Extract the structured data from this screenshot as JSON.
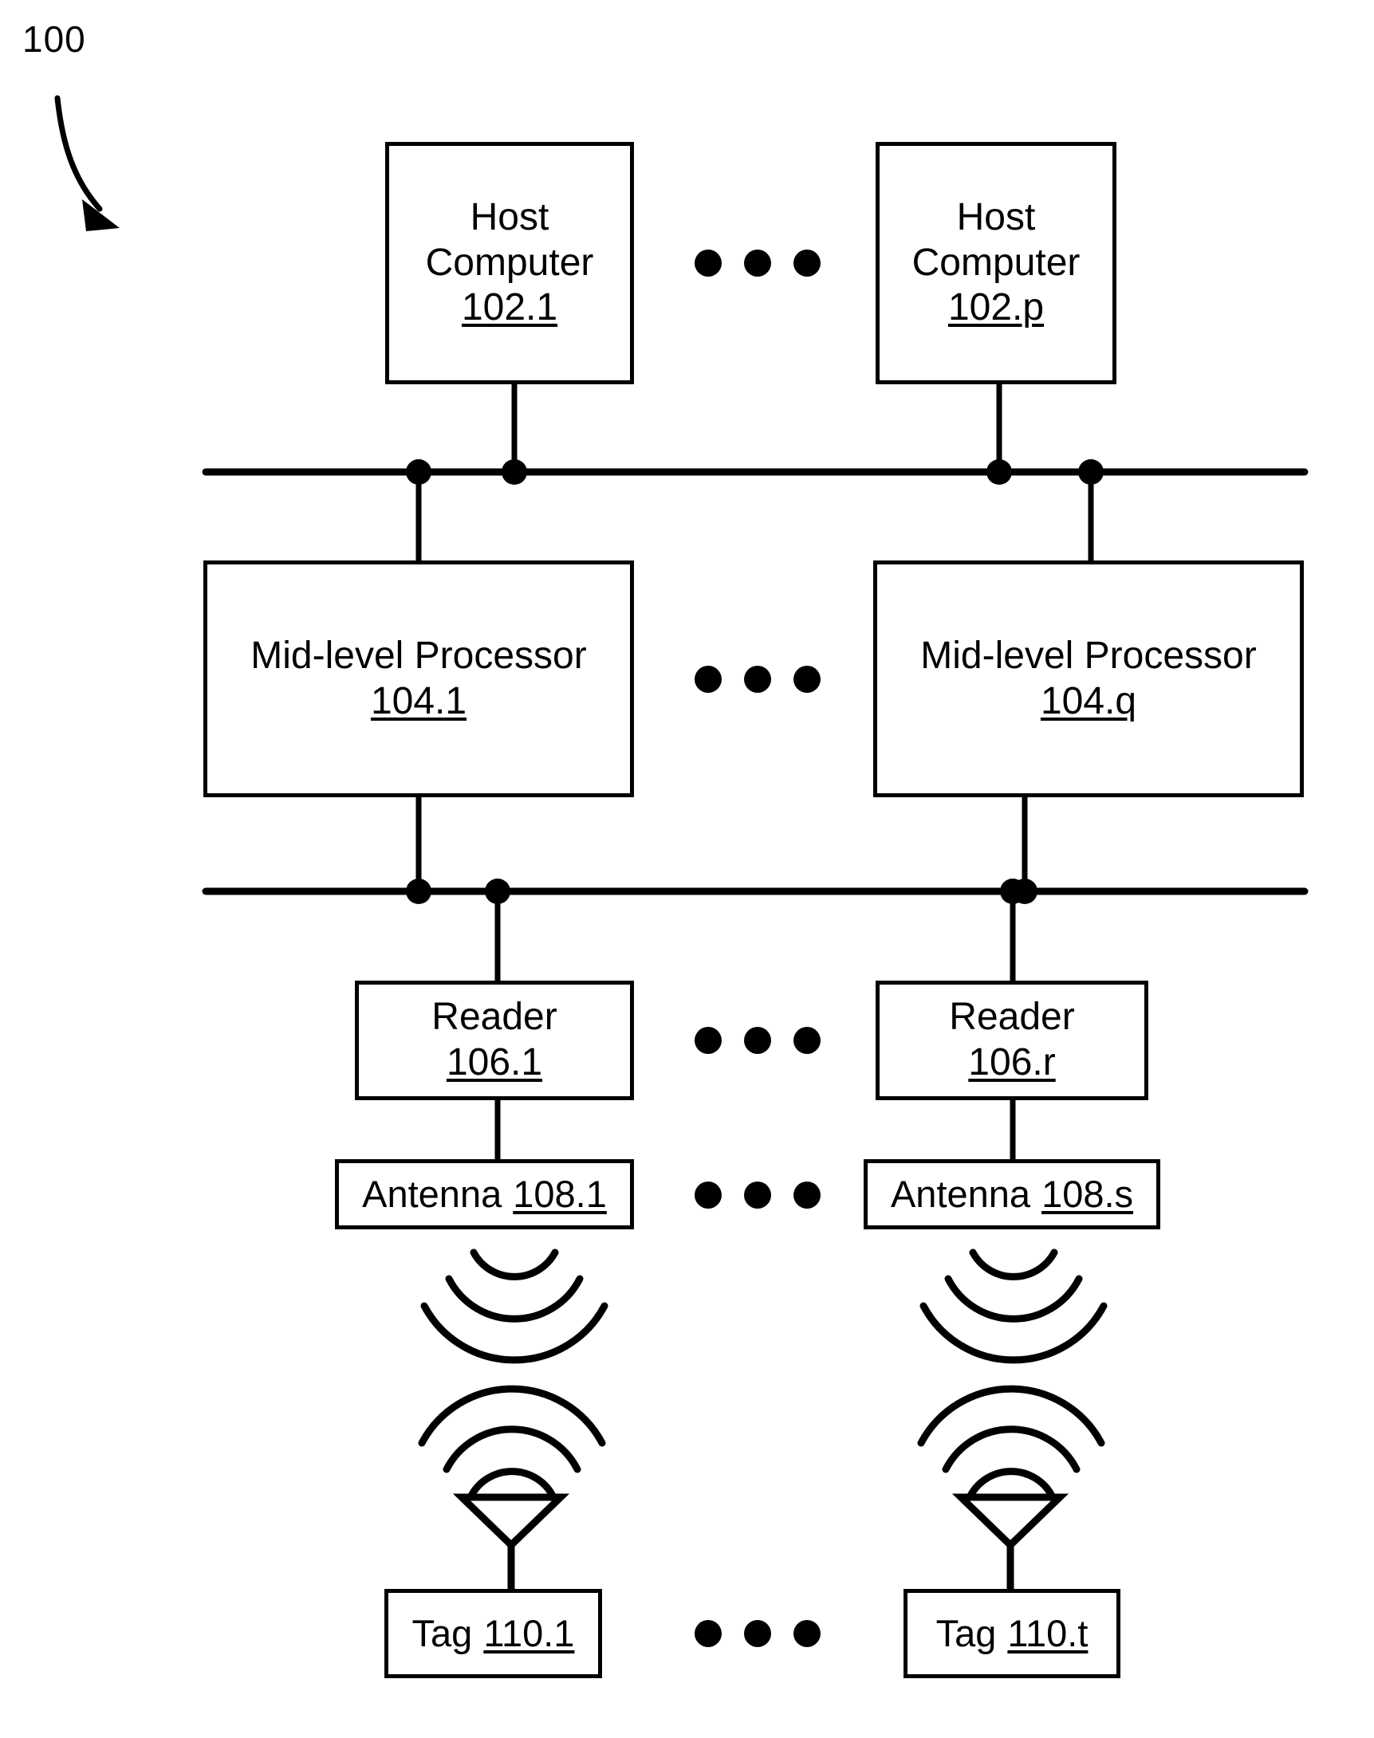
{
  "figure": {
    "number_label": "100",
    "title": "RFID system block diagram",
    "stroke_color": "#000000",
    "background_color": "#ffffff"
  },
  "tiers": {
    "hosts": {
      "tier_name": "Host Computer tier",
      "nodes": [
        {
          "id": "host-1",
          "line1": "Host",
          "line2": "Computer",
          "ref": "102.1"
        },
        {
          "id": "host-p",
          "line1": "Host",
          "line2": "Computer",
          "ref": "102.p"
        }
      ],
      "ellipsis_dots": 3
    },
    "processors": {
      "tier_name": "Mid-level Processor tier",
      "nodes": [
        {
          "id": "proc-1",
          "line1": "Mid-level Processor",
          "ref": "104.1"
        },
        {
          "id": "proc-q",
          "line1": "Mid-level Processor",
          "ref": "104.q"
        }
      ],
      "ellipsis_dots": 3
    },
    "readers": {
      "tier_name": "Reader tier",
      "nodes": [
        {
          "id": "reader-1",
          "line1": "Reader",
          "ref": "106.1"
        },
        {
          "id": "reader-r",
          "line1": "Reader",
          "ref": "106.r"
        }
      ],
      "ellipsis_dots": 3
    },
    "antennas": {
      "tier_name": "Antenna tier",
      "nodes": [
        {
          "id": "antenna-1",
          "line1": "Antenna",
          "ref": "108.1"
        },
        {
          "id": "antenna-s",
          "line1": "Antenna",
          "ref": "108.s"
        }
      ],
      "ellipsis_dots": 3
    },
    "tags": {
      "tier_name": "Tag tier",
      "nodes": [
        {
          "id": "tag-1",
          "line1": "Tag",
          "ref": "110.1"
        },
        {
          "id": "tag-t",
          "line1": "Tag",
          "ref": "110.t"
        }
      ],
      "ellipsis_dots": 3
    }
  },
  "buses": [
    {
      "id": "upper-bus",
      "name": "host-to-processor bus",
      "junction_count": 4
    },
    {
      "id": "lower-bus",
      "name": "processor-to-reader bus",
      "junction_count": 4
    }
  ],
  "rf_links": [
    {
      "id": "rf-link-left",
      "arcs_from_antenna": 3,
      "arcs_to_tag": 3
    },
    {
      "id": "rf-link-right",
      "arcs_from_antenna": 3,
      "arcs_to_tag": 3
    }
  ]
}
